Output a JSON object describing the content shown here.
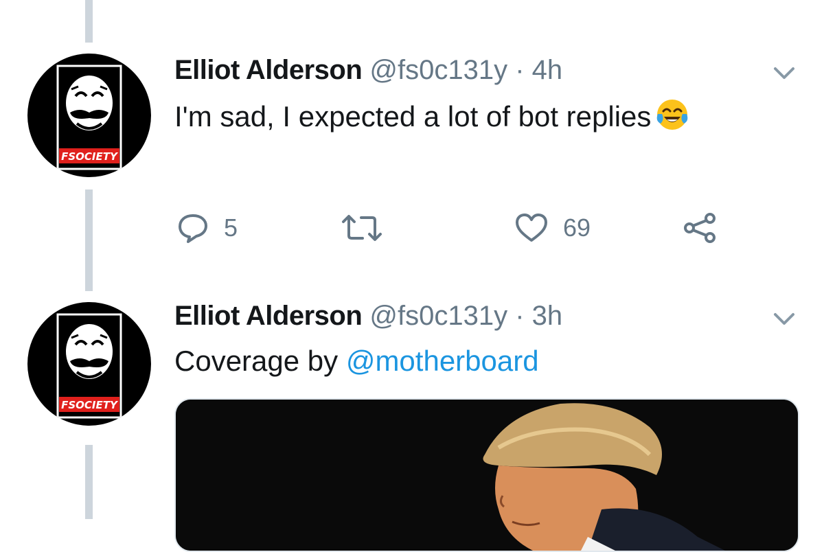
{
  "tweets": [
    {
      "author": "Elliot Alderson",
      "handle": "@fs0c131y",
      "separator": "·",
      "time": "4h",
      "text": "I'm sad, I expected a lot of bot replies",
      "emoji": "face-with-tears-of-joy-icon",
      "actions": {
        "reply_count": "5",
        "retweet_count": "",
        "like_count": "69"
      }
    },
    {
      "author": "Elliot Alderson",
      "handle": "@fs0c131y",
      "separator": "·",
      "time": "3h",
      "text_prefix": "Coverage by ",
      "mention": "@motherboard"
    }
  ],
  "avatar": {
    "label": "FSOCIETY"
  },
  "colors": {
    "text": "#14171a",
    "secondary": "#657786",
    "link": "#1b95e0",
    "thread_line": "#cdd5dc",
    "badge_red": "#e0201c"
  }
}
